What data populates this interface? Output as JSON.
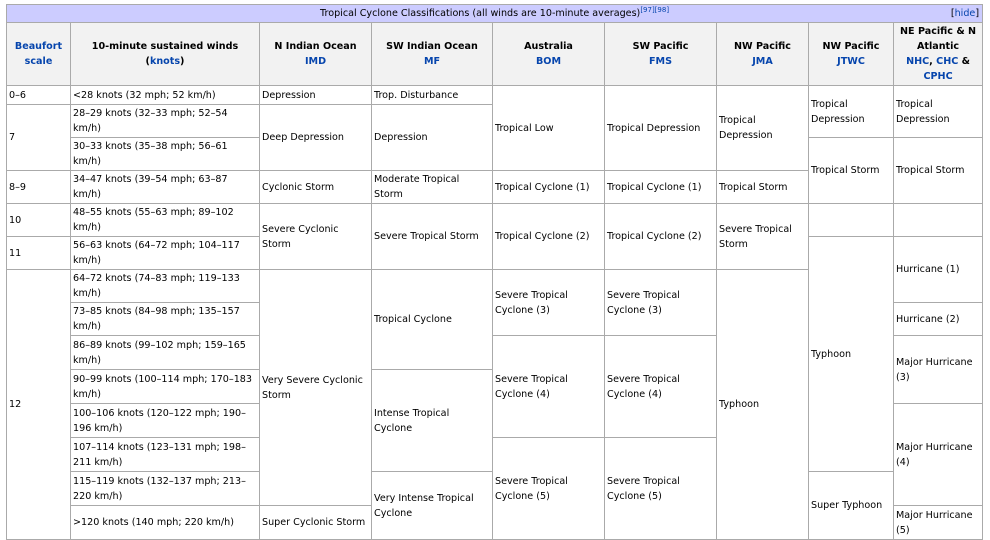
{
  "title": "Tropical Cyclone Classifications (all winds are 10-minute averages)",
  "title_refs": "[97][98]",
  "hide_link": "hide",
  "headers": {
    "beaufort": "Beaufort scale",
    "winds_prefix": "10-minute sustained winds (",
    "winds_link": "knots",
    "winds_suffix": ")",
    "nio": {
      "region": "N Indian Ocean",
      "agency": "IMD"
    },
    "swio": {
      "region": "SW Indian Ocean",
      "agency": "MF"
    },
    "aus": {
      "region": "Australia",
      "agency": "BOM"
    },
    "swp": {
      "region": "SW Pacific",
      "agency": "FMS"
    },
    "nwp_jma": {
      "region": "NW Pacific",
      "agency": "JMA"
    },
    "nwp_jtwc": {
      "region": "NW Pacific",
      "agency": "JTWC"
    },
    "nep": {
      "region": "NE Pacific & N Atlantic",
      "agency1": "NHC",
      "agency2": "CHC",
      "amp": "&",
      "agency3": "CPHC"
    }
  },
  "beaufort": [
    "0–6",
    "7",
    "8–9",
    "10",
    "11",
    "12"
  ],
  "winds": [
    "<28 knots (32 mph; 52 km/h)",
    "28–29 knots (32–33 mph; 52–54 km/h)",
    "30–33 knots (35–38 mph; 56–61 km/h)",
    "34–47 knots (39–54 mph; 63–87 km/h)",
    "48–55 knots (55–63 mph; 89–102 km/h)",
    "56–63 knots (64–72 mph; 104–117 km/h)",
    "64–72 knots (74–83 mph; 119–133 km/h)",
    "73–85 knots (84–98 mph; 135–157 km/h)",
    "86–89 knots (99–102 mph; 159–165 km/h)",
    "90–99 knots (100–114 mph; 170–183 km/h)",
    "100–106 knots (120–122 mph; 190–196 km/h)",
    "107–114 knots (123–131 mph; 198–211 km/h)",
    "115–119 knots (132–137 mph; 213–220 km/h)",
    ">120 knots (140 mph; 220 km/h)"
  ],
  "nio": [
    "Depression",
    "Deep Depression",
    "Cyclonic Storm",
    "Severe Cyclonic Storm",
    "Very Severe Cyclonic Storm",
    "Super Cyclonic Storm"
  ],
  "swio": [
    "Trop. Disturbance",
    "Depression",
    "Moderate Tropical Storm",
    "Severe Tropical Storm",
    "Tropical Cyclone",
    "Intense Tropical Cyclone",
    "Very Intense Tropical Cyclone"
  ],
  "aus": [
    "Tropical Low",
    "Tropical Cyclone (1)",
    "Tropical Cyclone (2)",
    "Severe Tropical Cyclone (3)",
    "Severe Tropical Cyclone (4)",
    "Severe Tropical Cyclone (5)"
  ],
  "swp": [
    "Tropical Depression",
    "Tropical Cyclone (1)",
    "Tropical Cyclone (2)",
    "Severe Tropical Cyclone (3)",
    "Severe Tropical Cyclone (4)",
    "Severe Tropical Cyclone (5)"
  ],
  "jma": [
    "Tropical Depression",
    "Tropical Storm",
    "Severe Tropical Storm",
    "Typhoon"
  ],
  "jtwc": [
    "Tropical Depression",
    "Tropical Storm",
    "Typhoon",
    "Super Typhoon"
  ],
  "nep": [
    "Tropical Depression",
    "Tropical Storm",
    "Hurricane (1)",
    "Hurricane (2)",
    "Major Hurricane (3)",
    "Major Hurricane (4)",
    "Major Hurricane (5)"
  ]
}
